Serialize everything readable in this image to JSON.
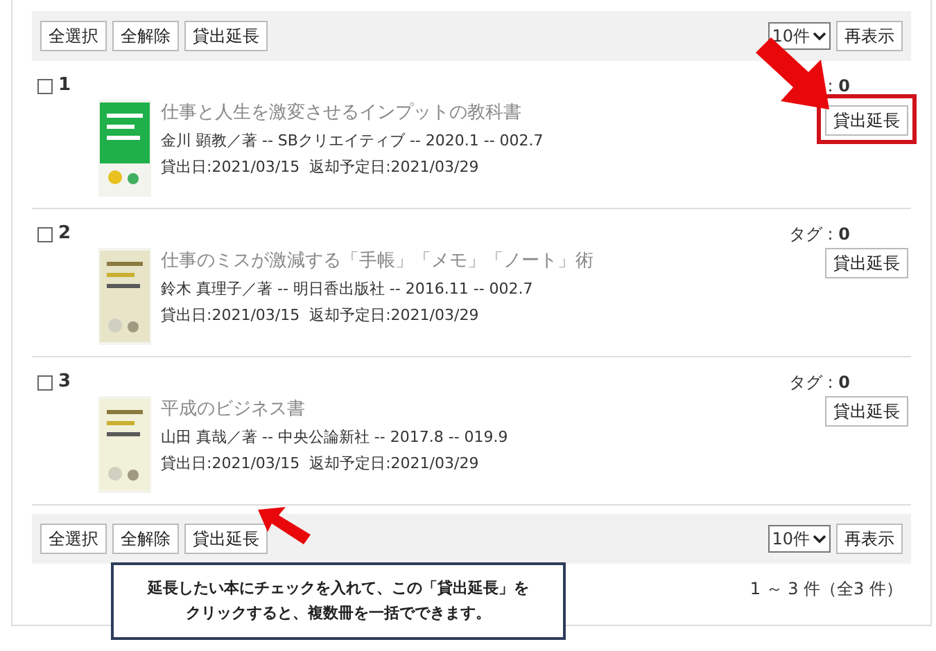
{
  "top_toolbar": {
    "buttons": [
      "全選択",
      "全解除",
      "貸出延長"
    ],
    "page_size": "10件",
    "refresh": "再表示"
  },
  "items": [
    {
      "number": "1",
      "checked": false,
      "tag": ": **0**",
      "title": "仕事と人生を激変させるインプットの教科書",
      "meta": "金川 顕教／著 -- SBクリエイティブ -- 2020.1 -- 002.7",
      "dates": "貸出日:2021/03/15  返却予定日:2021/03/29",
      "button": "貸出延長",
      "highlighted": true
    },
    {
      "number": "2",
      "checked": false,
      "tag": "タグ : **0**",
      "title": "仕事のミスが激減する「手帳」「メモ」「ノート」術",
      "meta": "鈴木 真理子／著 -- 明日香出版社 -- 2016.11 -- 002.7",
      "dates": "貸出日:2021/03/15  返却予定日:2021/03/29",
      "button": "貸出延長",
      "highlighted": false
    },
    {
      "number": "3",
      "checked": false,
      "tag": "タグ : **0**",
      "title": "平成のビジネス書",
      "meta": "山田 真哉／著 -- 中央公論新社 -- 2017.8 -- 019.9",
      "dates": "貸出日:2021/03/15  返却予定日:2021/03/29",
      "button": "貸出延長",
      "highlighted": false
    }
  ],
  "bottom_toolbar": {
    "buttons": [
      "全選択",
      "全解除",
      "貸出延長"
    ],
    "page_size": "10件",
    "refresh": "再表示"
  },
  "pagination": "1 ～ 3 件（全3 件）",
  "callout": {
    "lines": [
      "延長したい本にチェックを入れて、この「貸出延長」を",
      "クリックすると、複数冊を一括でできます。"
    ]
  }
}
